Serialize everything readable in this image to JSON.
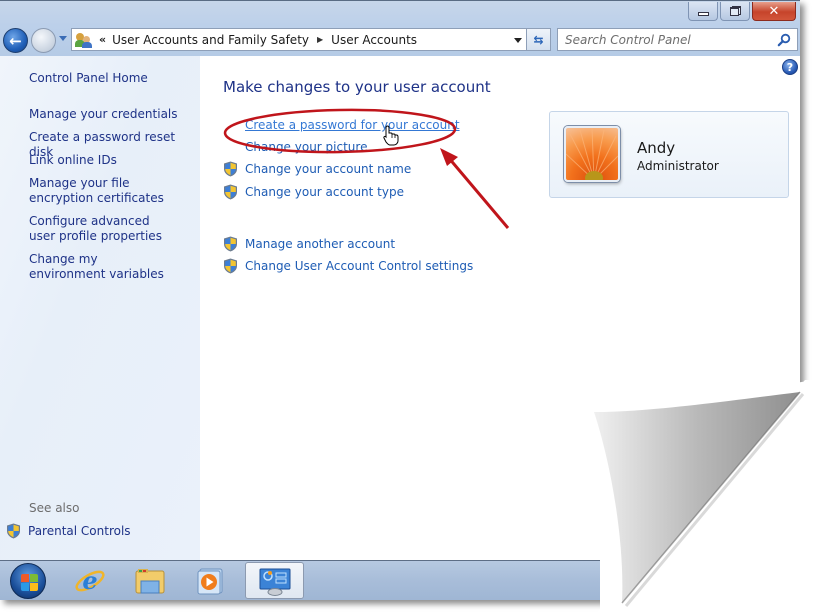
{
  "window": {
    "caption_buttons": {
      "minimize_label": "Minimize",
      "restore_label": "Restore",
      "close_label": "Close",
      "close_glyph": "✕"
    }
  },
  "navigation": {
    "back_glyph": "←",
    "breadcrumb": {
      "overflow_glyph": "«",
      "separator_glyph": "▶",
      "items": [
        "User Accounts and Family Safety",
        "User Accounts"
      ]
    },
    "refresh_glyph": "⇆"
  },
  "search": {
    "placeholder": "Search Control Panel",
    "value": ""
  },
  "sidebar": {
    "home_label": "Control Panel Home",
    "items": [
      {
        "label": "Manage your credentials"
      },
      {
        "label": "Create a password reset disk"
      },
      {
        "label": "Link online IDs"
      },
      {
        "label": "Manage your file encryption certificates"
      },
      {
        "label": "Configure advanced user profile properties"
      },
      {
        "label": "Change my environment variables"
      }
    ],
    "see_also_label": "See also",
    "see_also_items": [
      {
        "label": "Parental Controls",
        "icon": "uac-shield-icon"
      }
    ]
  },
  "main": {
    "help_glyph": "?",
    "title": "Make changes to your user account",
    "tasks": [
      {
        "label": "Create a password for your account",
        "shield": false,
        "hovered": true
      },
      {
        "label": "Change your picture",
        "shield": false
      },
      {
        "label": "Change your account name",
        "shield": true
      },
      {
        "label": "Change your account type",
        "shield": true
      },
      {
        "label": "Manage another account",
        "shield": true
      },
      {
        "label": "Change User Account Control settings",
        "shield": true
      }
    ],
    "account": {
      "name": "Andy",
      "role": "Administrator",
      "picture": "orange-flower-picture"
    }
  },
  "taskbar": {
    "items": [
      {
        "name": "start-button",
        "icon": "windows-orb-icon"
      },
      {
        "name": "internet-explorer",
        "icon": "ie-icon"
      },
      {
        "name": "windows-explorer",
        "icon": "folder-icon"
      },
      {
        "name": "media-player",
        "icon": "media-player-icon"
      },
      {
        "name": "control-panel",
        "icon": "control-panel-icon",
        "active": true
      }
    ]
  },
  "annotation": {
    "type": "highlight-ellipse-with-arrow",
    "color": "#c0151b",
    "target": "Create a password for your account"
  },
  "colors": {
    "link": "#1e5cb4",
    "sidebar_link": "#1e3287",
    "title": "#1e3287",
    "annotation": "#c0151b"
  }
}
